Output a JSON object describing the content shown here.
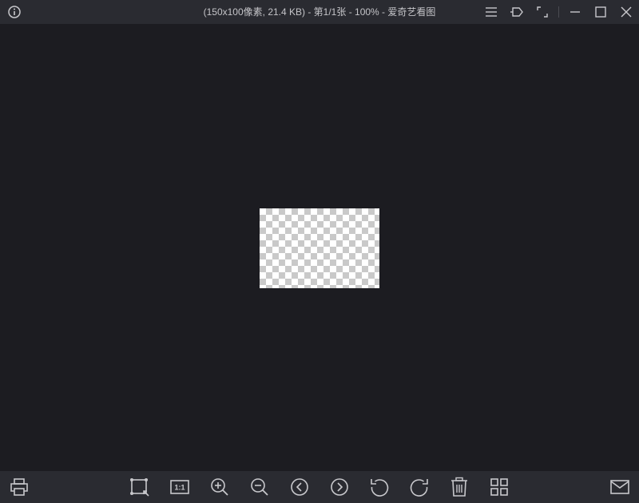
{
  "window": {
    "title": "(150x100像素, 21.4 KB) - 第1/1张 - 100% - 爱奇艺看图"
  },
  "titlebar_icons": [
    "info-icon",
    "menu-icon",
    "pin-icon",
    "fullscreen-icon",
    "minimize-icon",
    "maximize-icon",
    "close-icon"
  ],
  "toolbar_icons": [
    "print-icon",
    "fit-window-icon",
    "actual-size-icon",
    "zoom-in-icon",
    "zoom-out-icon",
    "previous-icon",
    "next-icon",
    "rotate-left-icon",
    "rotate-right-icon",
    "delete-icon",
    "thumbnails-icon",
    "email-icon"
  ],
  "toolbar": {
    "actual_size_label": "1:1"
  },
  "colors": {
    "background": "#1c1c21",
    "bar": "#2a2b31",
    "icon": "#c8c8cc"
  }
}
